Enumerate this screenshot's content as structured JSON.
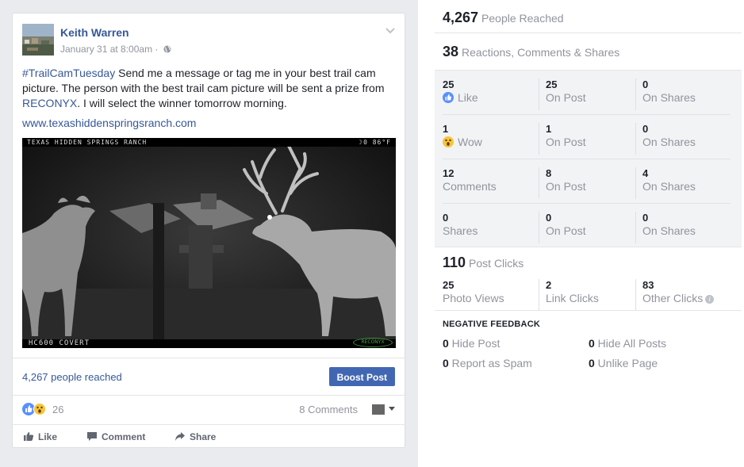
{
  "post": {
    "author": "Keith Warren",
    "timestamp": "January 31 at 8:00am · ",
    "text_hashtag": "#TrailCamTuesday",
    "text_part1": " Send me a message or tag me in your best trail cam picture. The person with the best trail cam picture will be sent a prize from ",
    "text_mention": "RECONYX",
    "text_part2": ". I will select the winner tomorrow morning.",
    "url": "www.texashiddenspringsranch.com",
    "photo": {
      "top_left_text": "TEXAS HIDDEN SPRINGS RANCH",
      "top_right_text": "☽0   86°F",
      "bottom_left_text": "HC600 COVERT",
      "logo_text": "RECONYX"
    },
    "reach_text": "4,267 people reached",
    "boost_label": "Boost Post",
    "reaction_count": "26",
    "comments_label": "8 Comments",
    "actions": {
      "like": "Like",
      "comment": "Comment",
      "share": "Share"
    }
  },
  "insights": {
    "people_reached": {
      "value": "4,267",
      "label": "People Reached"
    },
    "engagement": {
      "value": "38",
      "label": "Reactions, Comments & Shares"
    },
    "rows": [
      {
        "c1_val": "25",
        "c1_lbl": "Like",
        "c2_val": "25",
        "c2_lbl": "On Post",
        "c3_val": "0",
        "c3_lbl": "On Shares"
      },
      {
        "c1_val": "1",
        "c1_lbl": "Wow",
        "c2_val": "1",
        "c2_lbl": "On Post",
        "c3_val": "0",
        "c3_lbl": "On Shares"
      },
      {
        "c1_val": "12",
        "c1_lbl": "Comments",
        "c2_val": "8",
        "c2_lbl": "On Post",
        "c3_val": "4",
        "c3_lbl": "On Shares"
      },
      {
        "c1_val": "0",
        "c1_lbl": "Shares",
        "c2_val": "0",
        "c2_lbl": "On Post",
        "c3_val": "0",
        "c3_lbl": "On Shares"
      }
    ],
    "post_clicks": {
      "value": "110",
      "label": "Post Clicks"
    },
    "clicks": [
      {
        "value": "25",
        "label": "Photo Views"
      },
      {
        "value": "2",
        "label": "Link Clicks"
      },
      {
        "value": "83",
        "label": "Other Clicks"
      }
    ],
    "negative_feedback": {
      "title": "NEGATIVE FEEDBACK",
      "hide_post": {
        "value": "0",
        "label": " Hide Post"
      },
      "hide_all": {
        "value": "0",
        "label": " Hide All Posts"
      },
      "report_spam": {
        "value": "0",
        "label": " Report as Spam"
      },
      "unlike_page": {
        "value": "0",
        "label": " Unlike Page"
      }
    }
  },
  "colors": {
    "link_blue": "#365899",
    "boost_blue": "#4267b2",
    "like_blue": "#5890ff",
    "wow_yellow": "#f7c43b",
    "gray_text": "#90949c"
  }
}
